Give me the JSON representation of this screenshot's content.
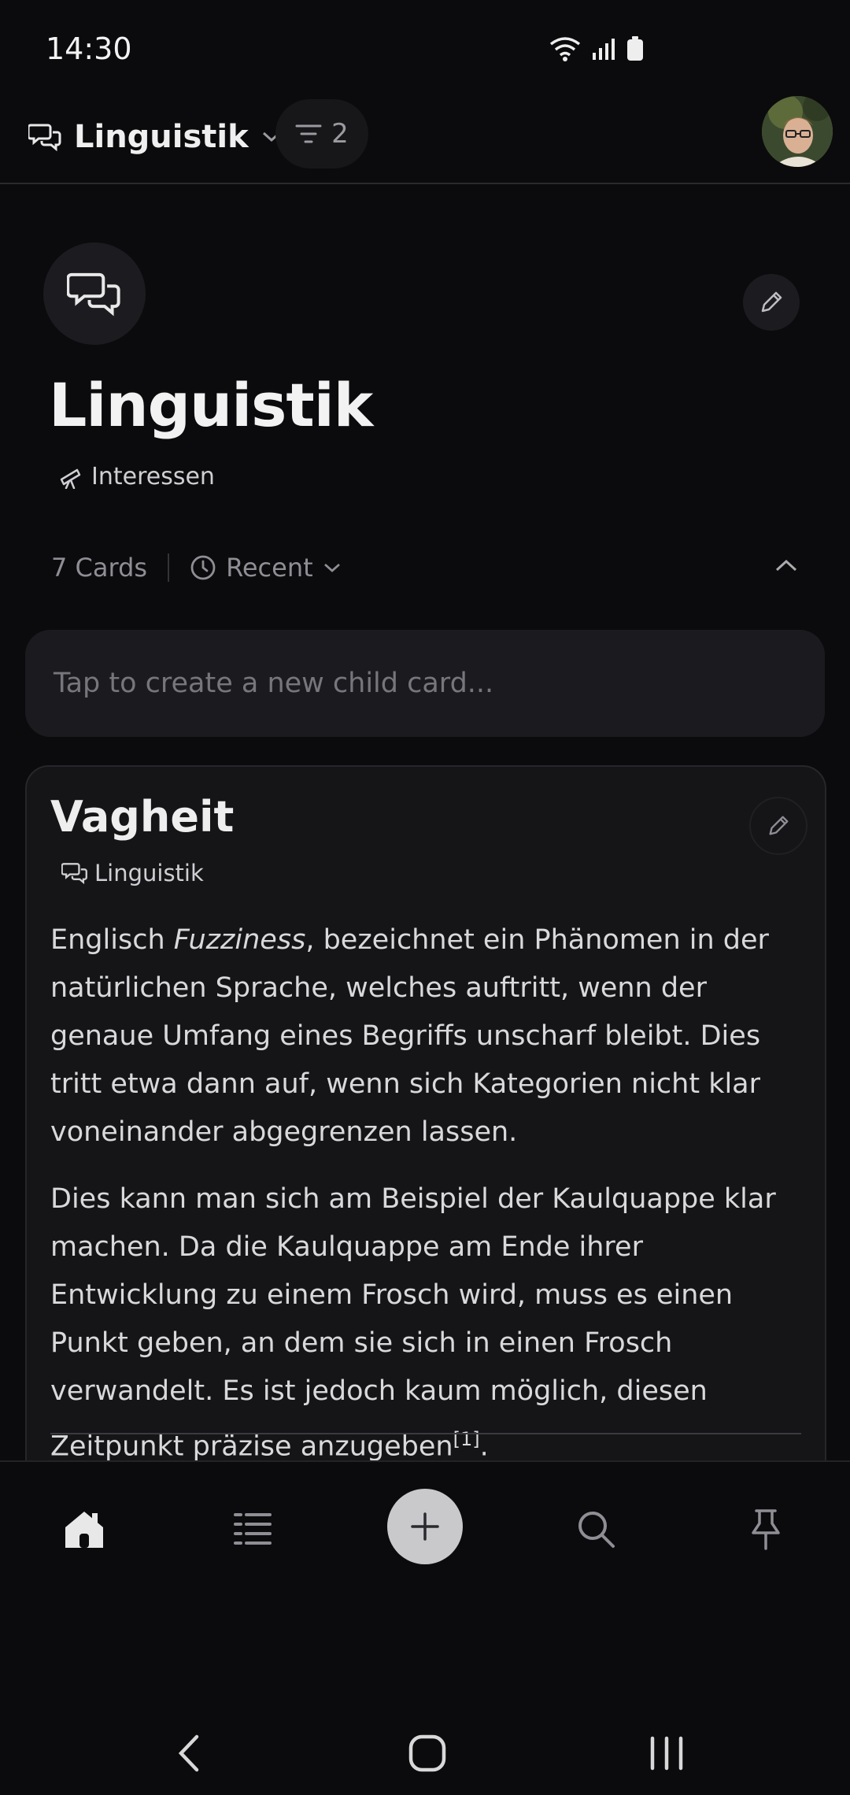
{
  "status": {
    "time": "14:30"
  },
  "topbar": {
    "title": "Linguistik",
    "filter_count": "2"
  },
  "page": {
    "title": "Linguistik",
    "tag": "Interessen",
    "card_count": "7 Cards",
    "sort_label": "Recent",
    "new_card_placeholder": "Tap to create a new child card..."
  },
  "card": {
    "title": "Vagheit",
    "tag": "Linguistik",
    "para1_before": "Englisch ",
    "para1_em": "Fuzziness",
    "para1_after": ", bezeichnet ein Phänomen in der natürlichen Sprache, welches auftritt, wenn der genaue Umfang eines Begriffs unscharf bleibt. Dies tritt etwa dann auf, wenn sich Kategorien nicht klar voneinander abgegrenzen lassen.",
    "para2": "Dies kann man sich am Beispiel der Kaulquappe klar machen. Da die Kaulquappe am Ende ihrer Entwicklung zu einem Frosch wird, muss es einen Punkt geben, an dem sie sich in einen Frosch verwandelt. Es ist jedoch kaum möglich, diesen Zeitpunkt präzise anzugeben",
    "footnote": "[1]",
    "para2_end": "."
  },
  "bottom_nav": {
    "icons": [
      "home-icon",
      "list-icon",
      "add-icon",
      "search-icon",
      "pin-icon"
    ]
  },
  "colors": {
    "background": "#0b0b0d",
    "card": "#151518",
    "fab": "#c9c9cc"
  }
}
